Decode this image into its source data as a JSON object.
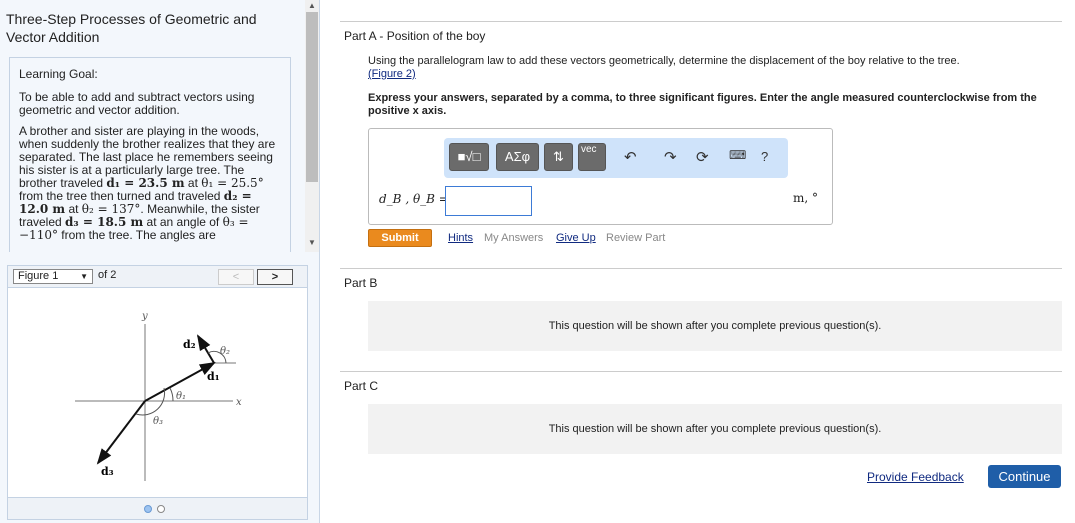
{
  "left": {
    "title": "Three-Step Processes of Geometric and Vector Addition",
    "goal_heading": "Learning Goal:",
    "goal_text": "To be able to add and subtract vectors using geometric and vector addition.",
    "problem": {
      "p1": "A brother and sister are playing in the woods, when suddenly the brother realizes that they are separated. The last place he remembers seeing his sister is at a particularly large tree. The brother traveled ",
      "d1": "d₁ = 23.5 m",
      "at1": " at ",
      "t1": "θ₁ = 25.5°",
      "p2": " from the tree then turned and traveled ",
      "d2": "d₂ = 12.0 m",
      "at2": " at ",
      "t2": "θ₂ = 137°",
      "p3": ". Meanwhile, the sister traveled ",
      "d3": "d₃ = 18.5 m",
      "p4": " at an angle of ",
      "t3": "θ₃ = −110°",
      "p5": " from the tree. The angles are"
    },
    "figure": {
      "selected": "Figure 1",
      "of": "of 2",
      "prev": "<",
      "next": ">",
      "labels": {
        "y": "y",
        "x": "x",
        "d1": "d₁",
        "d2": "d₂",
        "d3": "d₃",
        "t1": "θ₁",
        "t2": "θ₂",
        "t3": "θ₃"
      }
    }
  },
  "partA": {
    "title_bold": "Part A",
    "title_rest": " - Position of the boy",
    "instruction": "Using the parallelogram law to add these vectors geometrically, determine the displacement of the boy relative to the tree.",
    "figure_link": "(Figure 2)",
    "express": "Express your answers, separated by a comma, to three significant figures. Enter the angle measured counterclockwise from the positive x axis.",
    "toolbar": {
      "templates": "■√□",
      "greek": "ΑΣφ",
      "arrows": "⇅",
      "vec": "vec",
      "help": "?"
    },
    "label": "d_B , θ_B =",
    "value": "",
    "units": "m, °",
    "submit": "Submit",
    "hints": "Hints",
    "my_answers": "My Answers",
    "give_up": "Give Up",
    "review": "Review Part"
  },
  "partB": {
    "title": "Part B",
    "locked": "This question will be shown after you complete previous question(s)."
  },
  "partC": {
    "title": "Part C",
    "locked": "This question will be shown after you complete previous question(s)."
  },
  "footer": {
    "feedback": "Provide Feedback",
    "continue": "Continue"
  }
}
